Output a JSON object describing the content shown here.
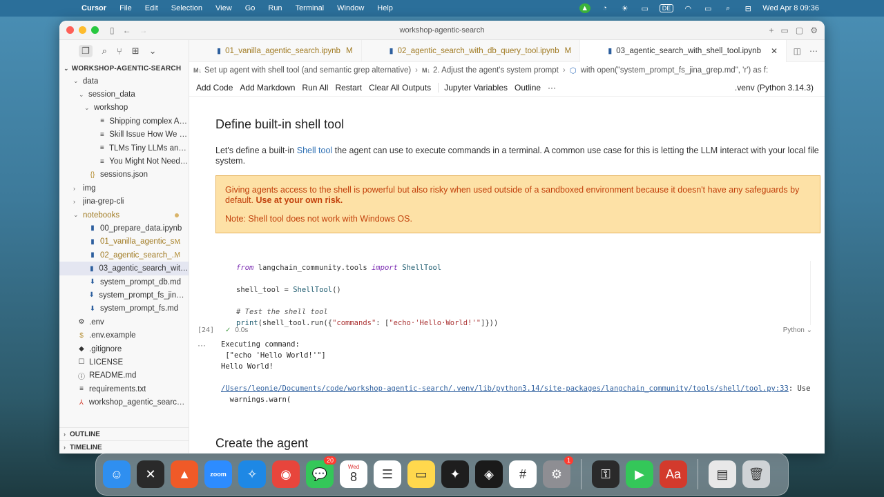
{
  "menubar": {
    "app": "Cursor",
    "items": [
      "File",
      "Edit",
      "Selection",
      "View",
      "Go",
      "Run",
      "Terminal",
      "Window",
      "Help"
    ],
    "input_source": "DE",
    "datetime": "Wed Apr 8  09:36"
  },
  "window": {
    "title": "workshop-agentic-search"
  },
  "explorer": {
    "title": "WORKSHOP-AGENTIC-SEARCH",
    "rows": [
      {
        "label": "data",
        "indent": 1,
        "chev": "⌄",
        "icon": ""
      },
      {
        "label": "session_data",
        "indent": 2,
        "chev": "⌄",
        "icon": ""
      },
      {
        "label": "workshop",
        "indent": 3,
        "chev": "⌄",
        "icon": ""
      },
      {
        "label": "Shipping complex AI ap...",
        "indent": 4,
        "chev": "",
        "icon": "≡"
      },
      {
        "label": "Skill Issue How We Use...",
        "indent": 4,
        "chev": "",
        "icon": "≡"
      },
      {
        "label": "TLMs Tiny LLMs and Ag...",
        "indent": 4,
        "chev": "",
        "icon": "≡"
      },
      {
        "label": "You Might Not Need 50 ...",
        "indent": 4,
        "chev": "",
        "icon": "≡"
      },
      {
        "label": "sessions.json",
        "indent": 2,
        "chev": "",
        "icon": "{}"
      },
      {
        "label": "img",
        "indent": 1,
        "chev": "›",
        "icon": ""
      },
      {
        "label": "jina-grep-cli",
        "indent": 1,
        "chev": "›",
        "icon": ""
      },
      {
        "label": "notebooks",
        "indent": 1,
        "chev": "⌄",
        "icon": ""
      },
      {
        "label": "00_prepare_data.ipynb",
        "indent": 2,
        "chev": "",
        "icon": "▮"
      },
      {
        "label": "01_vanilla_agentic_s...",
        "indent": 2,
        "chev": "",
        "icon": "▮",
        "badge": "M"
      },
      {
        "label": "02_agentic_search_...",
        "indent": 2,
        "chev": "",
        "icon": "▮",
        "badge": "M"
      },
      {
        "label": "03_agentic_search_with_...",
        "indent": 2,
        "chev": "",
        "icon": "▮"
      },
      {
        "label": "system_prompt_db.md",
        "indent": 2,
        "chev": "",
        "icon": "⬇"
      },
      {
        "label": "system_prompt_fs_jina_g...",
        "indent": 2,
        "chev": "",
        "icon": "⬇"
      },
      {
        "label": "system_prompt_fs.md",
        "indent": 2,
        "chev": "",
        "icon": "⬇"
      },
      {
        "label": ".env",
        "indent": 0,
        "chev": "",
        "icon": "⚙"
      },
      {
        "label": ".env.example",
        "indent": 0,
        "chev": "",
        "icon": "$"
      },
      {
        "label": ".gitignore",
        "indent": 0,
        "chev": "",
        "icon": "◆"
      },
      {
        "label": "LICENSE",
        "indent": 0,
        "chev": "",
        "icon": "☐"
      },
      {
        "label": "README.md",
        "indent": 0,
        "chev": "",
        "icon": "ⓘ"
      },
      {
        "label": "requirements.txt",
        "indent": 0,
        "chev": "",
        "icon": "≡"
      },
      {
        "label": "workshop_agentic_search....",
        "indent": 0,
        "chev": "",
        "icon": "⅄"
      }
    ],
    "outline_label": "OUTLINE",
    "timeline_label": "TIMELINE"
  },
  "tabs": [
    {
      "label": "01_vanilla_agentic_search.ipynb",
      "status": "M",
      "active": false
    },
    {
      "label": "02_agentic_search_with_db_query_tool.ipynb",
      "status": "M",
      "active": false
    },
    {
      "label": "03_agentic_search_with_shell_tool.ipynb",
      "status": "",
      "active": true
    }
  ],
  "breadcrumb": {
    "part1": "Set up agent with shell tool (and semantic grep alternative)",
    "part2": "2. Adjust the agent's system prompt",
    "part3": "with open(\"system_prompt_fs_jina_grep.md\", 'r') as f:"
  },
  "notebook_toolbar": {
    "buttons": [
      "Add Code",
      "Add Markdown",
      "Run All",
      "Restart",
      "Clear All Outputs",
      "Jupyter Variables",
      "Outline"
    ],
    "more": "···",
    "kernel": ".venv (Python 3.14.3)"
  },
  "markdown": {
    "heading": "Define built-in shell tool",
    "para_before": "Let's define a built-in ",
    "para_link": "Shell tool",
    "para_after": " the agent can use to execute commands in a terminal. A common use case for this is letting the LLM interact with your local file system.",
    "warning_text": "Giving agents access to the shell is powerful but also risky when used outside of a sandboxed environment because it doesn't have any safeguards by default. ",
    "warning_bold": "Use at your own risk.",
    "note": "Note: Shell tool does not work with Windows OS."
  },
  "code_cell": {
    "exec_count": "[24]",
    "duration": "0.0s",
    "language": "Python"
  },
  "output": {
    "line1": "Executing command:",
    "line2": " [\"echo 'Hello World!'\"]",
    "line3": "Hello World!",
    "path": "/Users/leonie/Documents/code/workshop-agentic-search/.venv/lib/python3.14/site-packages/langchain_community/tools/shell/tool.py:33",
    "path_suffix": ": Use",
    "line5": "  warnings.warn("
  },
  "next_heading": "Create the agent",
  "dock": {
    "apps": [
      {
        "name": "finder",
        "color": "#2f8ff0",
        "glyph": "☺"
      },
      {
        "name": "perplexity",
        "color": "#2a2a2a",
        "glyph": "✕"
      },
      {
        "name": "affinity",
        "color": "#f05a28",
        "glyph": "▲"
      },
      {
        "name": "zoom",
        "color": "#2d8cff",
        "glyph": "zoom"
      },
      {
        "name": "safari",
        "color": "#1e88e5",
        "glyph": "✧"
      },
      {
        "name": "chrome",
        "color": "#e8453c",
        "glyph": "◉"
      },
      {
        "name": "messages",
        "color": "#34c759",
        "glyph": "💬",
        "badge": "20"
      },
      {
        "name": "calendar",
        "color": "#ffffff",
        "glyph": "8",
        "sub": "Wed"
      },
      {
        "name": "reminders",
        "color": "#ffffff",
        "glyph": "☰"
      },
      {
        "name": "notes",
        "color": "#ffd84d",
        "glyph": "▭"
      },
      {
        "name": "figma",
        "color": "#1e1e1e",
        "glyph": "✦"
      },
      {
        "name": "cursor",
        "color": "#1a1a1a",
        "glyph": "◈"
      },
      {
        "name": "slack",
        "color": "#ffffff",
        "glyph": "#"
      },
      {
        "name": "system-settings",
        "color": "#8e8e93",
        "glyph": "⚙",
        "badge": "1"
      },
      {
        "name": "keychain",
        "color": "#2a2a2a",
        "glyph": "⚿"
      },
      {
        "name": "facetime",
        "color": "#34c759",
        "glyph": "▶"
      },
      {
        "name": "dictionary",
        "color": "#d33a2c",
        "glyph": "Aa"
      },
      {
        "name": "preview",
        "color": "#e8e8e8",
        "glyph": "▤"
      },
      {
        "name": "trash",
        "color": "#cfd3d6",
        "glyph": "🗑"
      }
    ]
  },
  "colors": {
    "accent": "#2d6fb3",
    "modified": "#a07a22",
    "warning_bg": "#fde1a6",
    "warning_text": "#c2410c"
  }
}
